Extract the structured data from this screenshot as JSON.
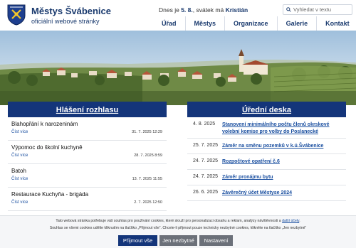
{
  "site": {
    "title": "Městys Švábenice",
    "subtitle": "oficiální webové stránky"
  },
  "today": {
    "prefix": "Dnes je",
    "date": "5. 8.",
    "middle": ", svátek má",
    "name": "Kristián"
  },
  "search": {
    "placeholder": "Vyhledat v textu"
  },
  "nav": [
    "Úřad",
    "Městys",
    "Organizace",
    "Galerie",
    "Kontakt"
  ],
  "announcements": {
    "heading": "Hlášení rozhlasu",
    "items": [
      {
        "title": "Blahopřání k narozeninám",
        "more": "Číst více",
        "date": "31. 7. 2025 12:29"
      },
      {
        "title": "Výpomoc do školní kuchyně",
        "more": "Číst více",
        "date": "28. 7. 2025 8:59"
      },
      {
        "title": "Batoh",
        "more": "Číst více",
        "date": "13. 7. 2025 11:55"
      },
      {
        "title": "Restaurace Kuchyňa - brigáda",
        "more": "Číst více",
        "date": "2. 7. 2025 12:50"
      }
    ]
  },
  "board": {
    "heading": "Úřední deska",
    "items": [
      {
        "date": "4. 8. 2025",
        "title": "Stanovení minimálního počtu členů okrskové volební komise pro volby do Poslanecké"
      },
      {
        "date": "25. 7. 2025",
        "title": "Záměr na směnu pozemků v k.ú.Švábenice"
      },
      {
        "date": "24. 7. 2025",
        "title": "Rozpočtové opatření č.6"
      },
      {
        "date": "24. 7. 2025",
        "title": "Záměr pronájmu bytu"
      },
      {
        "date": "26. 6. 2025",
        "title": "Závěrečný účet Městyse 2024"
      }
    ]
  },
  "cookies": {
    "line1": "Tato webová stránka potřebuje váš souhlas pro používání cookies, které slouží pro personalizaci obsahu a reklam, analýzy návštěvnosti a",
    "line1_link": "další účely",
    "line2": "Souhlas se všemi cookies udělte kliknutím na tlačítko „Přijmout vše“. Chcete-li přijmout pouze technicky nezbytné cookies, klikněte na tlačítko „Jen nezbytné“",
    "accept": "Přijmout vše",
    "necessary": "Jen nezbytné",
    "settings": "Nastavení"
  },
  "colors": {
    "brand_blue": "#14357a",
    "link_blue": "#1a4fa0",
    "button_grey": "#6b7079"
  },
  "icons": [
    "coat-of-arms-icon",
    "search-icon"
  ]
}
